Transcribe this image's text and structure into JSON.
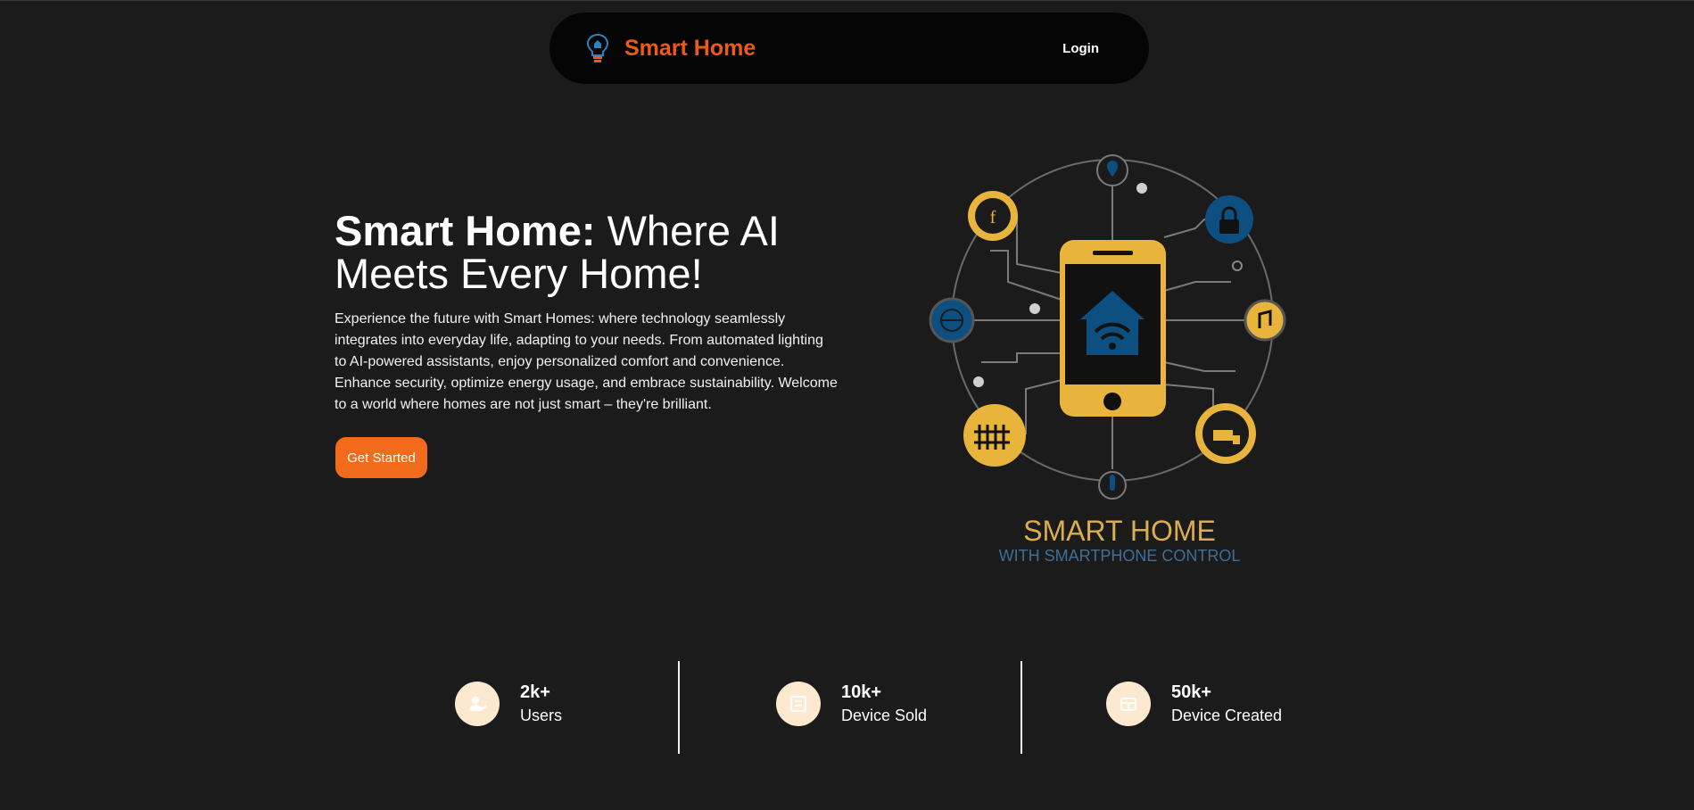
{
  "nav": {
    "brand_name": "Smart Home",
    "login_label": "Login",
    "icon": "lightbulb-icon"
  },
  "hero": {
    "title_strong": "Smart Home:",
    "title_rest": " Where AI Meets Every Home!",
    "description": "Experience the future with Smart Homes: where technology seamlessly integrates into everyday life, adapting to your needs. From automated lighting to AI-powered assistants, enjoy personalized comfort and convenience. Enhance security, optimize energy usage, and embrace sustainability. Welcome to a world where homes are not just smart – they're brilliant.",
    "cta_label": "Get Started"
  },
  "illustration": {
    "title": "SMART HOME",
    "subtitle": "WITH SMARTPHONE CONTROL"
  },
  "stats": [
    {
      "value": "2k+",
      "label": "Users",
      "icon": "user-check-icon"
    },
    {
      "value": "10k+",
      "label": "Device Sold",
      "icon": "device-icon"
    },
    {
      "value": "50k+",
      "label": "Device Created",
      "icon": "device-create-icon"
    }
  ],
  "colors": {
    "background": "#1b1b1b",
    "nav_background": "#050505",
    "brand": "#ea5a18",
    "cta": "#f26a1b",
    "stat_icon_bg": "#fde9cf",
    "illustration_yellow": "#e9b43c",
    "illustration_blue": "#0d4f80"
  }
}
